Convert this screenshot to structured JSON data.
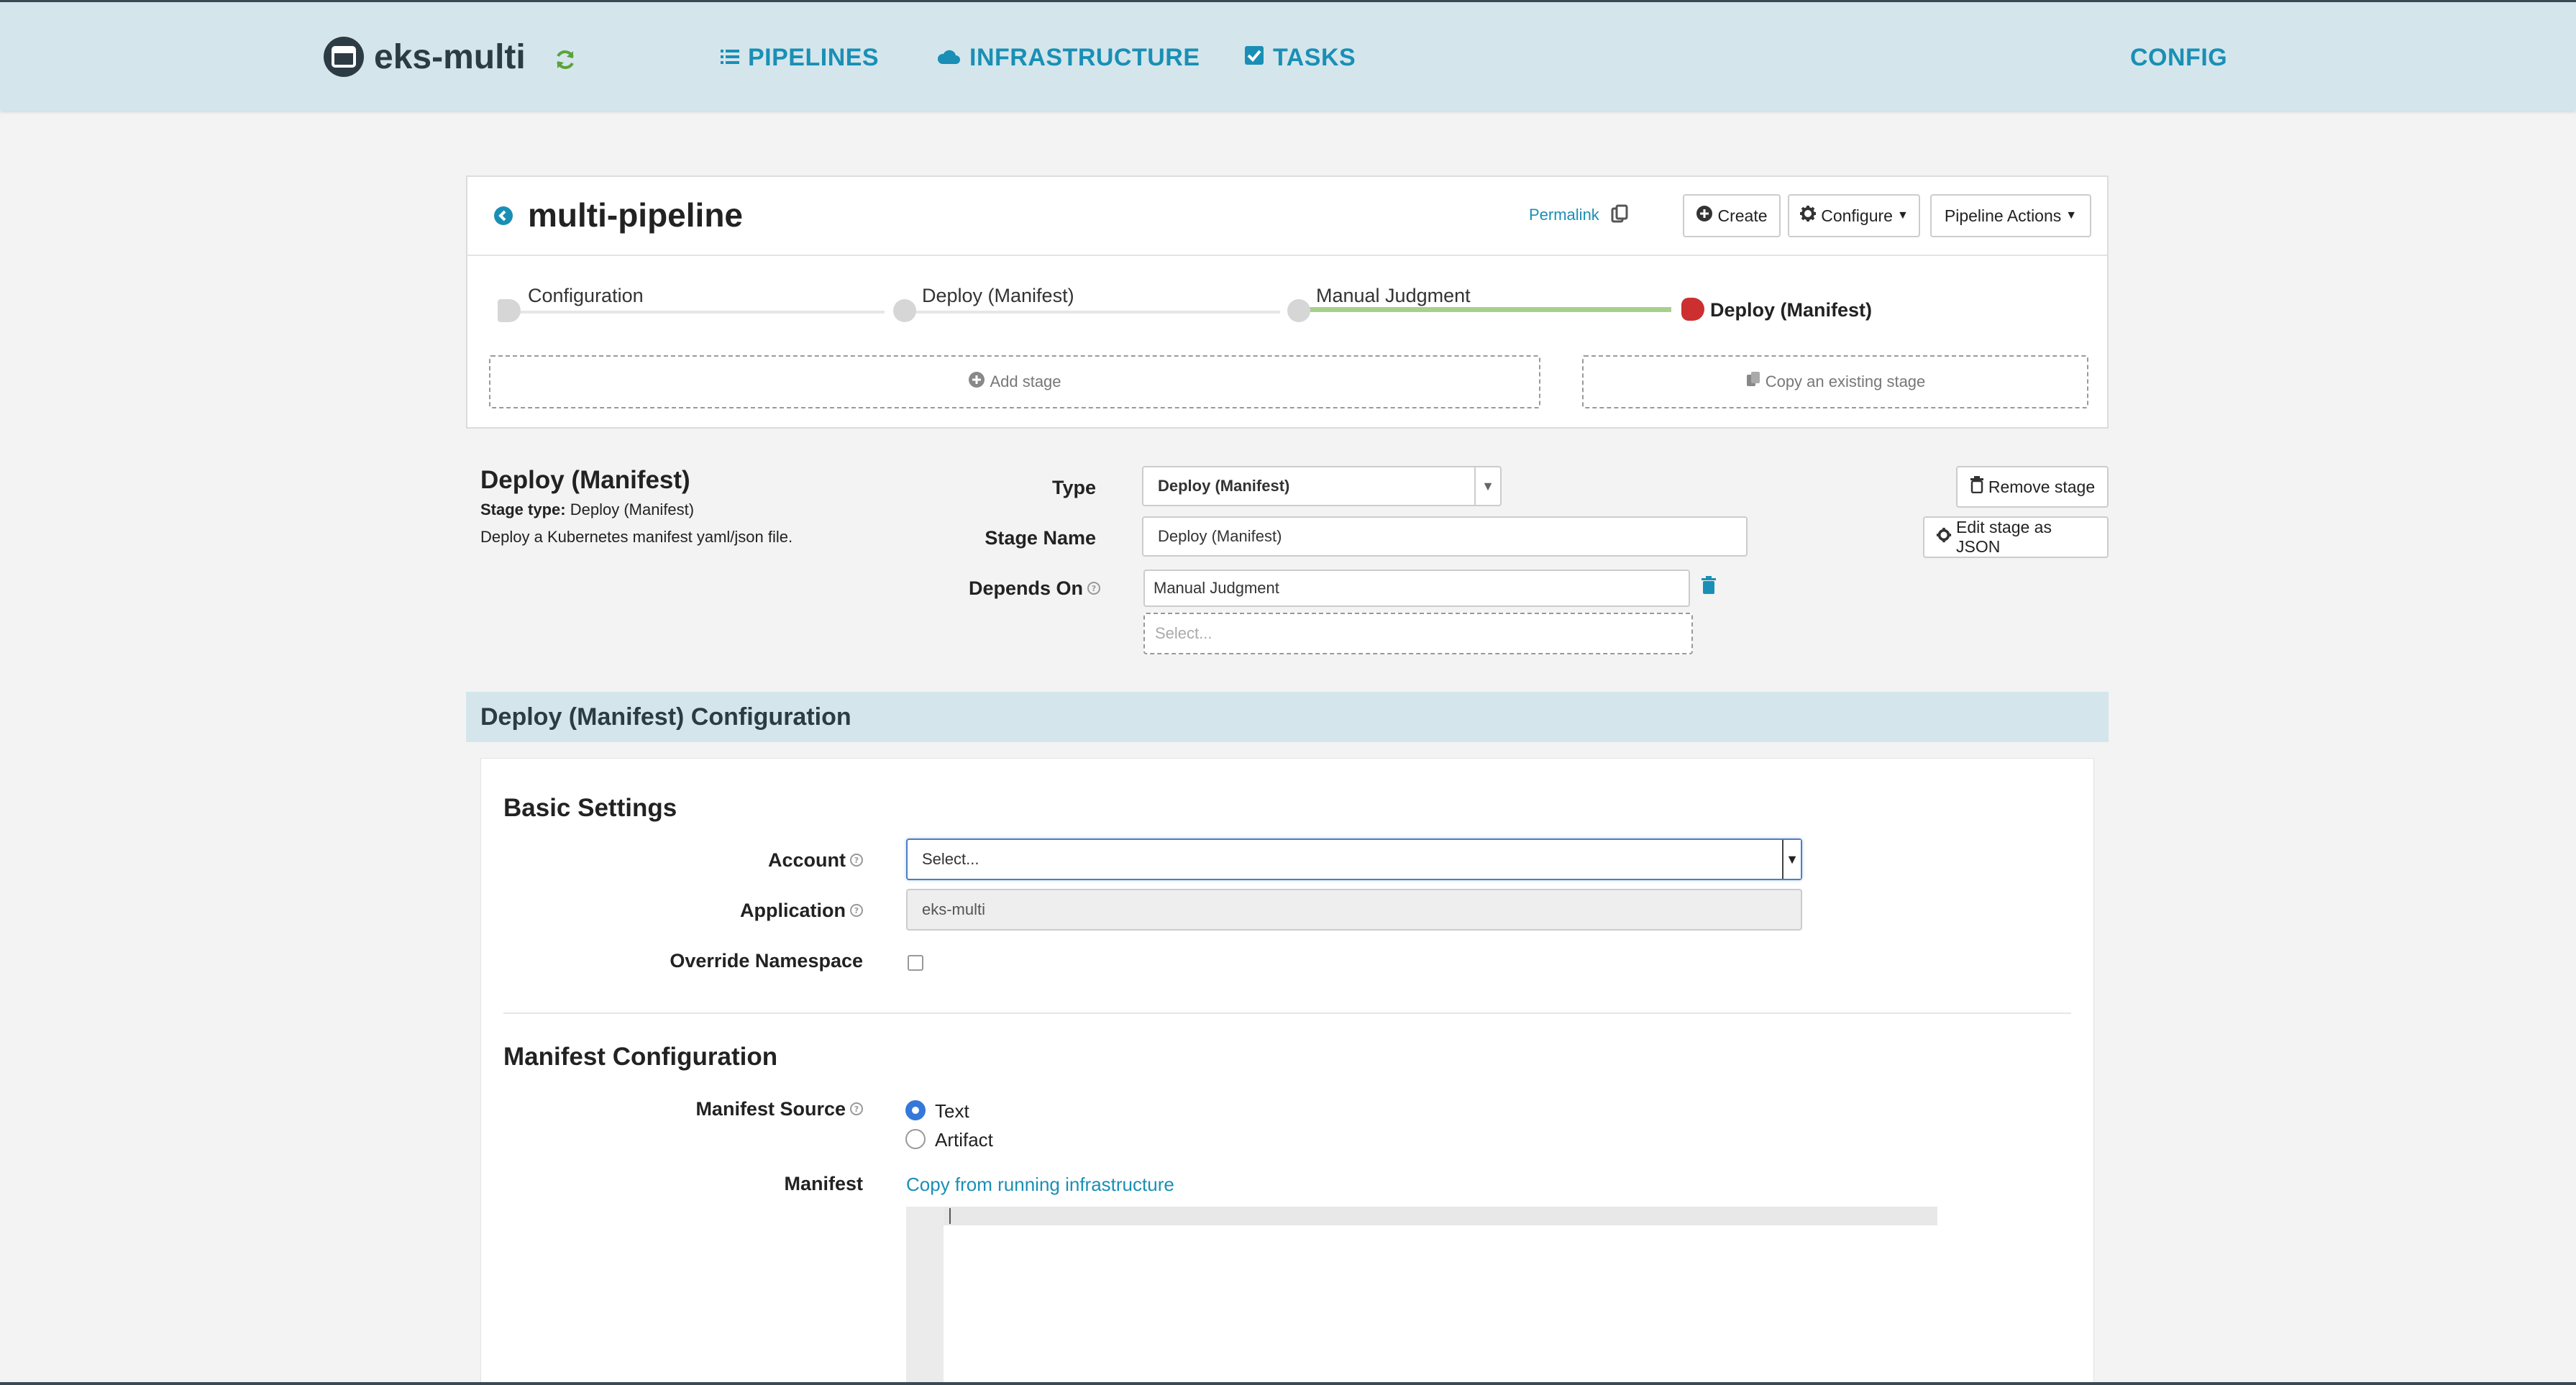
{
  "app": {
    "name": "eks-multi"
  },
  "nav": {
    "pipelines": "PIPELINES",
    "infrastructure": "INFRASTRUCTURE",
    "tasks": "TASKS",
    "config": "CONFIG"
  },
  "pipeline": {
    "title": "multi-pipeline",
    "permalink": "Permalink",
    "create": "Create",
    "configure": "Configure",
    "actions": "Pipeline Actions",
    "stages": [
      {
        "label": "Configuration"
      },
      {
        "label": "Deploy (Manifest)"
      },
      {
        "label": "Manual Judgment"
      },
      {
        "label": "Deploy (Manifest)"
      }
    ],
    "add_stage": "Add stage",
    "copy_stage": "Copy an existing stage"
  },
  "stage": {
    "title": "Deploy (Manifest)",
    "type_label": "Stage type:",
    "type_value": "Deploy (Manifest)",
    "description": "Deploy a Kubernetes manifest yaml/json file.",
    "fields": {
      "type_label": "Type",
      "type_value": "Deploy (Manifest)",
      "name_label": "Stage Name",
      "name_value": "Deploy (Manifest)",
      "depends_label": "Depends On",
      "depends_value": "Manual Judgment",
      "depends_placeholder": "Select..."
    },
    "remove": "Remove stage",
    "edit_json": "Edit stage as JSON"
  },
  "config": {
    "header": "Deploy (Manifest) Configuration",
    "basic_settings": "Basic Settings",
    "account_label": "Account",
    "account_value": "Select...",
    "application_label": "Application",
    "application_value": "eks-multi",
    "override_label": "Override Namespace",
    "manifest_config": "Manifest Configuration",
    "source_label": "Manifest Source",
    "source_text": "Text",
    "source_artifact": "Artifact",
    "manifest_label": "Manifest",
    "copy_link": "Copy from running infrastructure"
  },
  "colors": {
    "accent": "#1a8fb5",
    "header_bg": "#d4e6ec",
    "current_stage": "#cc2f2f",
    "progress": "#a8d08d"
  },
  "icons": {
    "app_logo": "window-icon",
    "refresh": "refresh-icon",
    "pipelines": "list-icon",
    "infrastructure": "cloud-icon",
    "tasks": "checkbox-icon",
    "back": "arrow-left-circle-icon",
    "copy": "clipboard-icon",
    "create": "plus-circle-icon",
    "configure": "gear-icon",
    "remove": "trash-icon",
    "help": "question-circle-icon"
  }
}
